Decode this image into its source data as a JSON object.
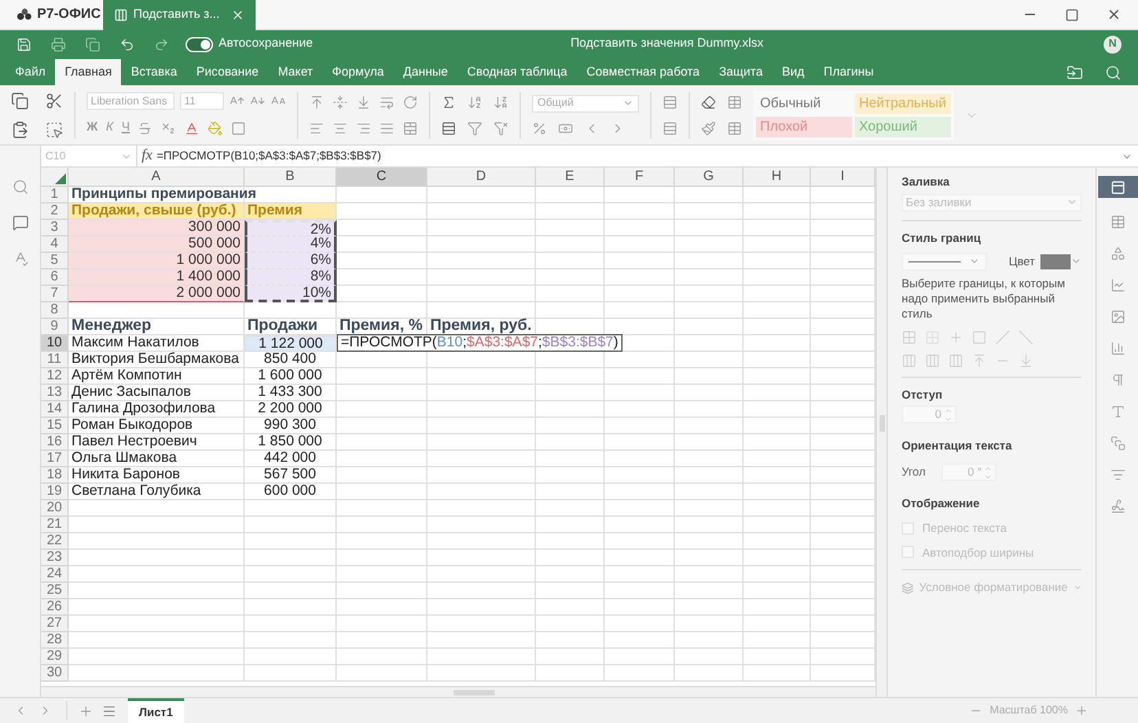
{
  "app": {
    "logo": "Р7-ОФИС",
    "tab": {
      "title": "Подставить з..."
    }
  },
  "toolbar": {
    "autosave": {
      "label": "Автосохранение",
      "on": true
    },
    "title": "Подставить значения Dummy.xlsx",
    "avatar": "N"
  },
  "menu": [
    {
      "label": "Файл",
      "selected": false
    },
    {
      "label": "Главная",
      "selected": true
    },
    {
      "label": "Вставка",
      "selected": false
    },
    {
      "label": "Рисование",
      "selected": false
    },
    {
      "label": "Макет",
      "selected": false
    },
    {
      "label": "Формула",
      "selected": false
    },
    {
      "label": "Данные",
      "selected": false
    },
    {
      "label": "Сводная таблица",
      "selected": false
    },
    {
      "label": "Совместная работа",
      "selected": false
    },
    {
      "label": "Защита",
      "selected": false
    },
    {
      "label": "Вид",
      "selected": false
    },
    {
      "label": "Плагины",
      "selected": false
    }
  ],
  "ribbon": {
    "font_name": "Liberation Sans",
    "font_size": "11",
    "format_letters": [
      "Ж",
      "К",
      "Ч"
    ],
    "number_format": "Общий",
    "styles": [
      {
        "label": "Обычный",
        "kind": "normal"
      },
      {
        "label": "Нейтральный",
        "kind": "neutral"
      },
      {
        "label": "Плохой",
        "kind": "bad"
      },
      {
        "label": "Хороший",
        "kind": "good"
      }
    ]
  },
  "formula_bar": {
    "cell": "C10",
    "fx": "fx",
    "formula": "=ПРОСМОТР(B10;$A$3:$A$7;$B$3:$B$7)"
  },
  "sheet": {
    "columns": [
      {
        "label": "A",
        "selected": false
      },
      {
        "label": "B",
        "selected": false
      },
      {
        "label": "C",
        "selected": true
      },
      {
        "label": "D",
        "selected": false
      },
      {
        "label": "E",
        "selected": false
      },
      {
        "label": "F",
        "selected": false
      },
      {
        "label": "G",
        "selected": false
      },
      {
        "label": "H",
        "selected": false
      },
      {
        "label": "I",
        "selected": false
      }
    ],
    "rows": [
      {
        "number": "1",
        "selected": false,
        "cells": [
          {
            "kind": "title",
            "text": "Принципы премирования"
          }
        ]
      },
      {
        "number": "2",
        "selected": false,
        "cells": [
          {
            "kind": "header",
            "text": "Продажи, свыше (руб.)"
          },
          {
            "kind": "header",
            "text": "Премия"
          }
        ]
      },
      {
        "number": "3",
        "selected": false,
        "cells": [
          {
            "kind": "threshold",
            "text": "300 000"
          },
          {
            "kind": "rate",
            "text": "2%"
          }
        ]
      },
      {
        "number": "4",
        "selected": false,
        "cells": [
          {
            "kind": "threshold",
            "text": "500 000"
          },
          {
            "kind": "rate",
            "text": "4%"
          }
        ]
      },
      {
        "number": "5",
        "selected": false,
        "cells": [
          {
            "kind": "threshold",
            "text": "1 000 000"
          },
          {
            "kind": "rate",
            "text": "6%"
          }
        ]
      },
      {
        "number": "6",
        "selected": false,
        "cells": [
          {
            "kind": "threshold",
            "text": "1 400 000"
          },
          {
            "kind": "rate",
            "text": "8%"
          }
        ]
      },
      {
        "number": "7",
        "selected": false,
        "cells": [
          {
            "kind": "threshold",
            "text": "2 000 000"
          },
          {
            "kind": "rate",
            "text": "10%"
          }
        ]
      },
      {
        "number": "8",
        "selected": false,
        "cells": []
      },
      {
        "number": "9",
        "selected": false,
        "cells": [
          {
            "kind": "colhead",
            "text": "Менеджер"
          },
          {
            "kind": "colhead",
            "text": "Продажи"
          },
          {
            "kind": "colhead",
            "text": "Премия, %"
          },
          {
            "kind": "colhead",
            "text": "Премия, руб."
          }
        ]
      },
      {
        "number": "10",
        "selected": true,
        "cells": [
          {
            "kind": "name",
            "text": "Максим Накатилов"
          },
          {
            "kind": "ref",
            "text": "1 122 000"
          },
          {
            "kind": "formula",
            "parts": [
              {
                "text": "=ПРОСМОТР(",
                "color": "#222222"
              },
              {
                "text": "B10",
                "color": "#5b8fd6"
              },
              {
                "text": ";",
                "color": "#222222"
              },
              {
                "text": "$A$3:$A$7",
                "color": "#e06666"
              },
              {
                "text": ";",
                "color": "#222222"
              },
              {
                "text": "$B$3:$B$7",
                "color": "#9c7fd0"
              },
              {
                "text": ")",
                "color": "#222222"
              }
            ]
          }
        ]
      },
      {
        "number": "11",
        "selected": false,
        "cells": [
          {
            "kind": "name",
            "text": "Виктория Бешбармакова"
          },
          {
            "kind": "amount",
            "text": "850 400"
          }
        ]
      },
      {
        "number": "12",
        "selected": false,
        "cells": [
          {
            "kind": "name",
            "text": "Артём Компотин"
          },
          {
            "kind": "amount",
            "text": "1 600 000"
          }
        ]
      },
      {
        "number": "13",
        "selected": false,
        "cells": [
          {
            "kind": "name",
            "text": "Денис Засыпалов"
          },
          {
            "kind": "amount",
            "text": "1 433 300"
          }
        ]
      },
      {
        "number": "14",
        "selected": false,
        "cells": [
          {
            "kind": "name",
            "text": "Галина Дрозофилова"
          },
          {
            "kind": "amount",
            "text": "2 200 000"
          }
        ]
      },
      {
        "number": "15",
        "selected": false,
        "cells": [
          {
            "kind": "name",
            "text": "Роман Быкодоров"
          },
          {
            "kind": "amount",
            "text": "990 300"
          }
        ]
      },
      {
        "number": "16",
        "selected": false,
        "cells": [
          {
            "kind": "name",
            "text": "Павел Нестроевич"
          },
          {
            "kind": "amount",
            "text": "1 850 000"
          }
        ]
      },
      {
        "number": "17",
        "selected": false,
        "cells": [
          {
            "kind": "name",
            "text": "Ольга Шмакова"
          },
          {
            "kind": "amount",
            "text": "442 000"
          }
        ]
      },
      {
        "number": "18",
        "selected": false,
        "cells": [
          {
            "kind": "name",
            "text": "Никита Баронов"
          },
          {
            "kind": "amount",
            "text": "567 500"
          }
        ]
      },
      {
        "number": "19",
        "selected": false,
        "cells": [
          {
            "kind": "name",
            "text": "Светлана Голубика"
          },
          {
            "kind": "amount",
            "text": "600 000"
          }
        ]
      },
      {
        "number": "20",
        "selected": false,
        "cells": []
      },
      {
        "number": "21",
        "selected": false,
        "cells": []
      },
      {
        "number": "22",
        "selected": false,
        "cells": []
      },
      {
        "number": "23",
        "selected": false,
        "cells": []
      },
      {
        "number": "24",
        "selected": false,
        "cells": []
      },
      {
        "number": "25",
        "selected": false,
        "cells": []
      },
      {
        "number": "26",
        "selected": false,
        "cells": []
      },
      {
        "number": "27",
        "selected": false,
        "cells": []
      },
      {
        "number": "28",
        "selected": false,
        "cells": []
      },
      {
        "number": "29",
        "selected": false,
        "cells": []
      },
      {
        "number": "30",
        "selected": false,
        "cells": []
      }
    ]
  },
  "panel": {
    "fill_title": "Заливка",
    "fill_value": "Без заливки",
    "border_title": "Стиль границ",
    "color_label": "Цвет",
    "border_hint": "Выберите границы, к которым надо применить выбранный стиль",
    "indent_title": "Отступ",
    "indent_value": "0",
    "orientation_title": "Ориентация текста",
    "angle_label": "Угол",
    "angle_value": "0 °",
    "display_title": "Отображение",
    "checkboxes": [
      {
        "label": "Перенос текста",
        "checked": false
      },
      {
        "label": "Автоподбор ширины",
        "checked": false
      }
    ],
    "conditional": "Условное форматирование"
  },
  "sheet_tabs": [
    {
      "label": "Лист1",
      "selected": true
    }
  ],
  "zoom": "Масштаб 100%"
}
